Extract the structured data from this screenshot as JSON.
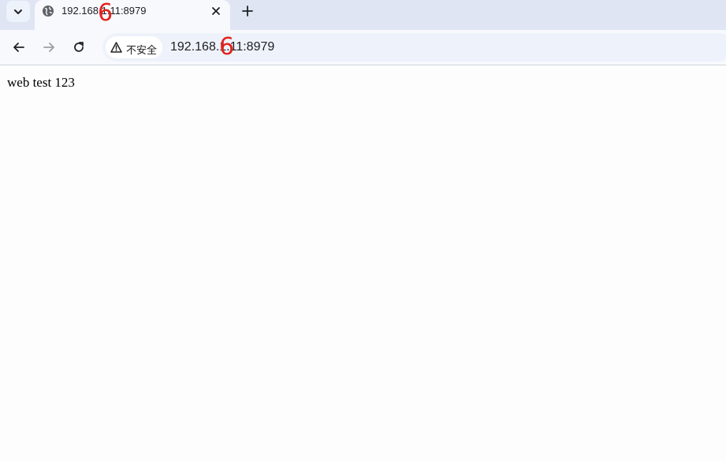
{
  "tab": {
    "title": "192.168.1.11:8979"
  },
  "toolbar": {
    "security_label": "不安全",
    "url": "192.168.1.11:8979"
  },
  "page": {
    "text": "web test 123"
  },
  "overlay": {
    "digit": "6",
    "color": "#e3221b"
  },
  "icons": {
    "tab_list": "chevron-down-icon",
    "favicon": "globe-icon",
    "close": "close-icon",
    "new_tab": "plus-icon",
    "back": "arrow-left-icon",
    "forward": "arrow-right-icon",
    "reload": "reload-icon",
    "security": "warning-triangle-icon"
  },
  "colors": {
    "tabstrip": "#dfe5f3",
    "toolbar": "#f8f9fd",
    "omnibox": "#eef2fa"
  }
}
